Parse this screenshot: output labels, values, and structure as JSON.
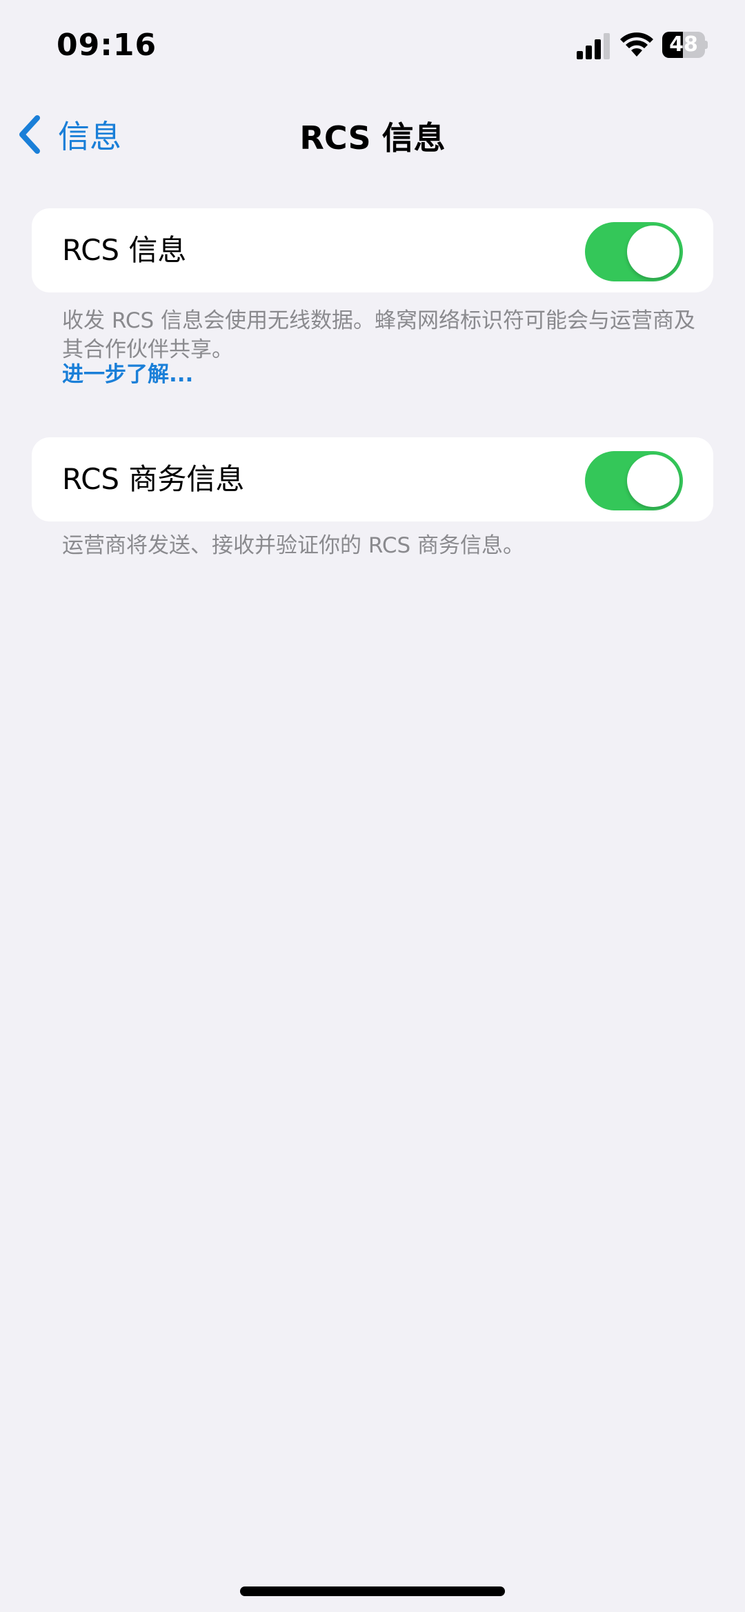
{
  "status_bar": {
    "time": "09:16",
    "battery_level": "48",
    "battery_fraction": 0.48,
    "icons": [
      "signal-icon",
      "wifi-icon",
      "battery-icon"
    ]
  },
  "nav": {
    "back_label": "信息",
    "title": "RCS 信息"
  },
  "settings": {
    "rcs_messaging": {
      "label": "RCS 信息",
      "enabled": true,
      "footer": "收发 RCS 信息会使用无线数据。蜂窝网络标识符可能会与运营商及其合作伙伴共享。",
      "link": "进一步了解..."
    },
    "rcs_business": {
      "label": "RCS 商务信息",
      "enabled": true,
      "footer": "运营商将发送、接收并验证你的 RCS 商务信息。"
    }
  },
  "colors": {
    "background": "#f2f1f6",
    "toggle_on": "#34c759",
    "link_blue": "#1a7fd8",
    "footer_gray": "#8a8a8e"
  }
}
